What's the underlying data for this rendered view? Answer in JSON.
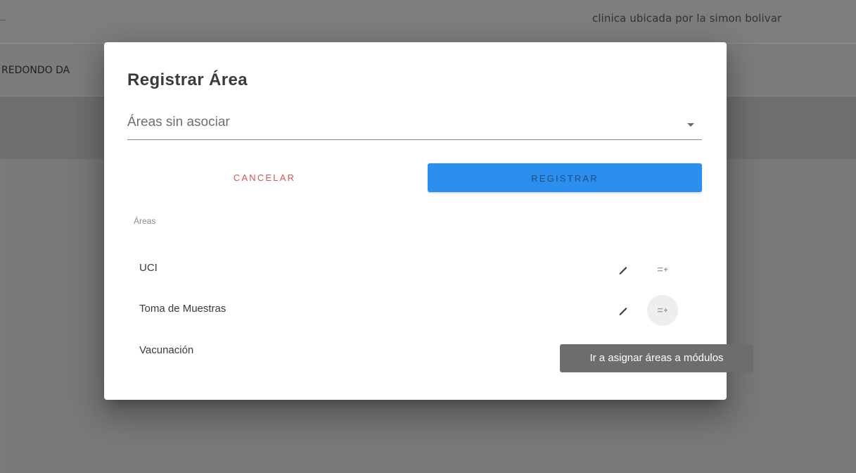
{
  "background": {
    "top_right_text": "clinica ubicada por la simon bolivar",
    "row_text": "REDONDO DA"
  },
  "dialog": {
    "title": "Registrar Área",
    "select": {
      "placeholder": "Áreas sin asociar"
    },
    "buttons": {
      "cancel": "CANCELAR",
      "register": "REGISTRAR"
    },
    "list": {
      "subheader": "Áreas",
      "items": [
        {
          "label": "UCI"
        },
        {
          "label": "Toma de Muestras"
        },
        {
          "label": "Vacunación"
        }
      ]
    }
  },
  "tooltip": {
    "text": "Ir a asignar áreas a módulos"
  },
  "icons": {
    "edit": "pencil-icon",
    "assign": "playlist-assign-icon"
  },
  "colors": {
    "primary": "#2b8ff0",
    "cancel": "#d9534f",
    "tooltip_bg": "#6d6d6d"
  }
}
